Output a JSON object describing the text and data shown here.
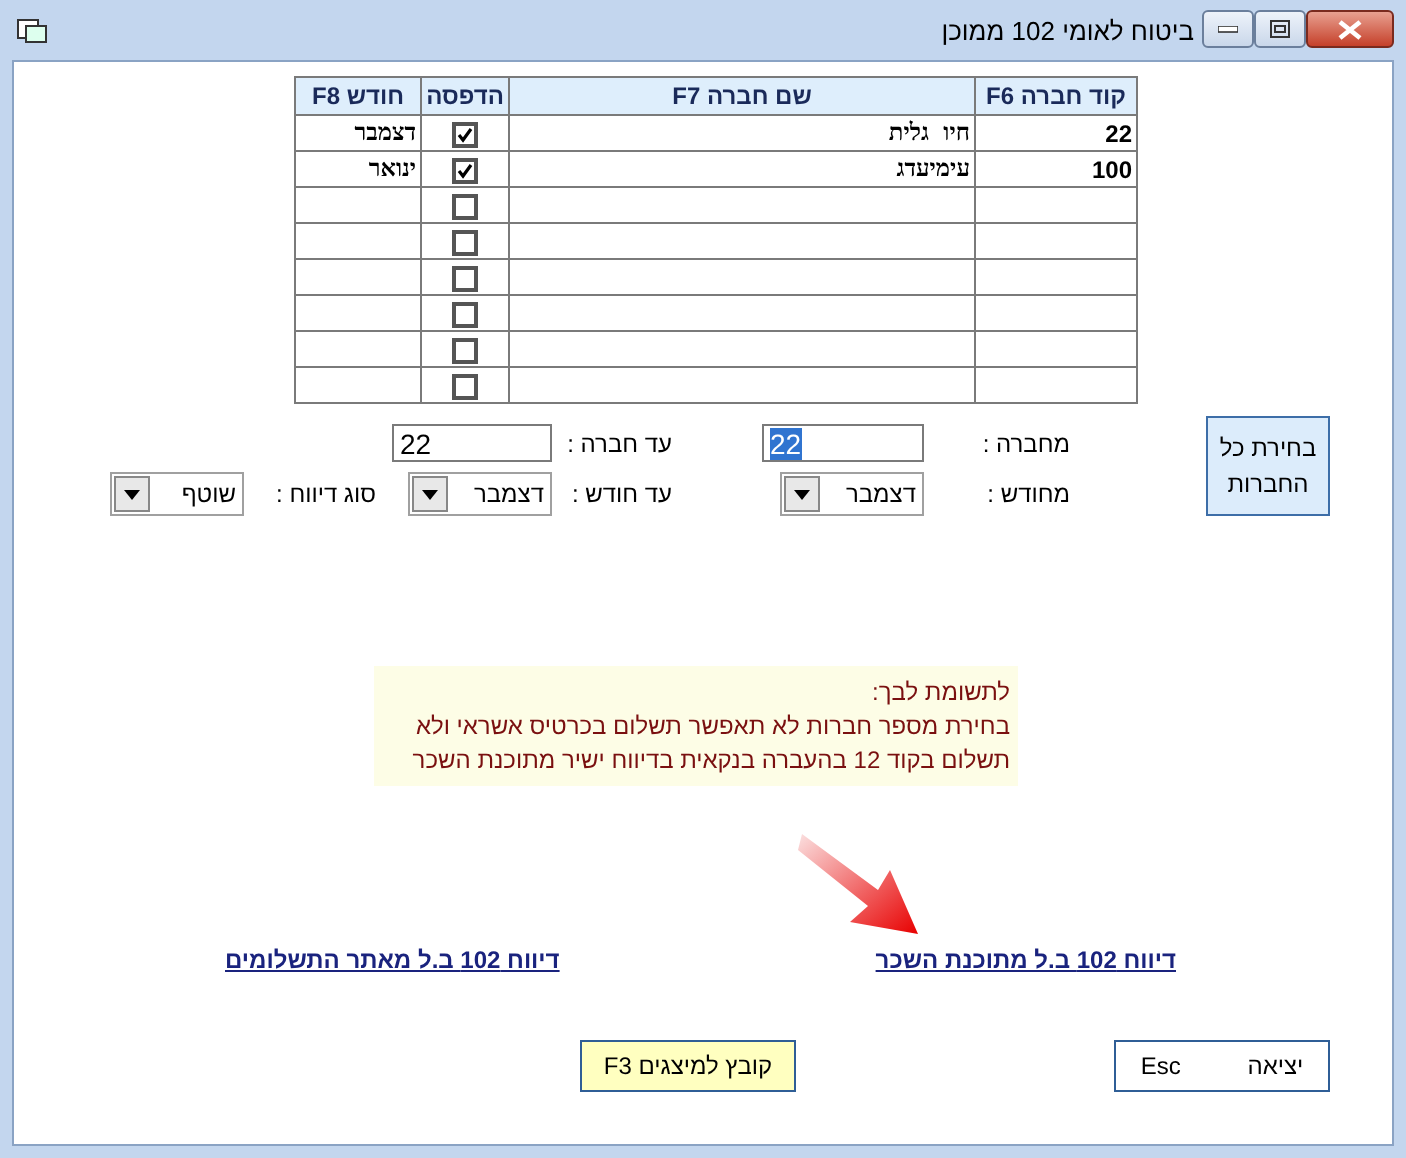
{
  "window": {
    "title": "ביטוח לאומי 102 ממוכן"
  },
  "table": {
    "columns": [
      "קוד חברה F6",
      "שם חברה F7",
      "הדפסה",
      "חודש F8"
    ],
    "rows": [
      {
        "code": "22",
        "name": "חיו גלית",
        "print": true,
        "month": "דצמבר"
      },
      {
        "code": "100",
        "name": "עימיעדג",
        "print": true,
        "month": "ינואר"
      },
      {
        "print": false
      },
      {
        "print": false
      },
      {
        "print": false
      },
      {
        "print": false
      },
      {
        "print": false
      },
      {
        "print": false
      }
    ]
  },
  "select_all_button": "בחירת כל החברות",
  "fields": [
    {
      "label": "מחברה :",
      "value": "22",
      "highlighted": true
    },
    {
      "label": "עד חברה :",
      "value": "22",
      "highlighted": false
    }
  ],
  "selects": [
    {
      "label": "מחודש :",
      "value": "דצמבר"
    },
    {
      "label": "עד חודש :",
      "value": "דצמבר"
    },
    {
      "label": "סוג דיווח :",
      "value": "שוטף"
    }
  ],
  "notice": {
    "lines": [
      "לתשומת לבך:",
      "בחירת מספר חברות לא תאפשר תשלום בכרטיס אשראי ולא",
      "תשלום בקוד 12 בהעברה בנקאית בדיווח ישיר מתוכנת השכר"
    ]
  },
  "links": [
    "דיווח 102 ב.ל מתוכנת השכר",
    "דיווח 102 ב.ל מאתר התשלומים"
  ],
  "buttons": [
    {
      "label": "יציאה Esc",
      "kind": "plain"
    },
    {
      "label": "קובץ למיצגים F3",
      "kind": "highlight"
    }
  ]
}
